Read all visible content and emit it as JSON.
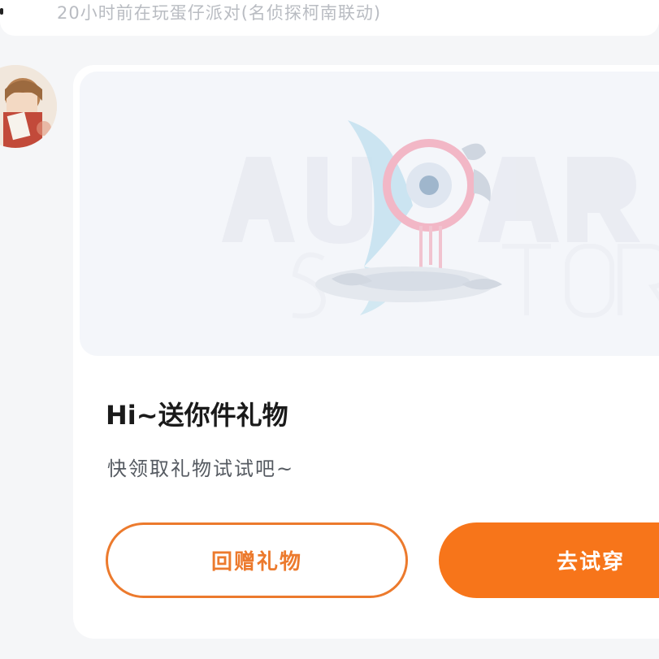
{
  "previous_message": {
    "status_text": "20小时前在玩蛋仔派对(名侦探柯南联动)"
  },
  "gift_card": {
    "banner_icon": "avatar-store-logo",
    "title": "Hi~送你件礼物",
    "subtitle": "快领取礼物试试吧~",
    "return_gift_label": "回赠礼物",
    "try_on_label": "去试穿"
  },
  "colors": {
    "accent": "#f7751a",
    "outline": "#ec7a2d",
    "card_bg": "#ffffff",
    "page_bg": "#f5f6f8"
  }
}
